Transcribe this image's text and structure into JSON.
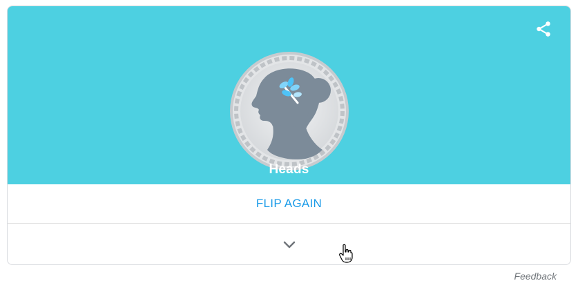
{
  "coin_flip": {
    "result_label": "Heads",
    "flip_again_label": "FLIP AGAIN"
  },
  "footer": {
    "feedback_label": "Feedback"
  },
  "icons": {
    "share": "share-icon",
    "expand": "chevron-down-icon",
    "coin": "coin-heads-icon",
    "cursor": "hand-pointer-icon"
  },
  "colors": {
    "hero_background": "#4dd0e1",
    "link_blue": "#1a9be8",
    "coin_silver": "#d9dcdf",
    "profile_gray": "#7c8b99",
    "laurel_blue": "#81d4fa"
  }
}
